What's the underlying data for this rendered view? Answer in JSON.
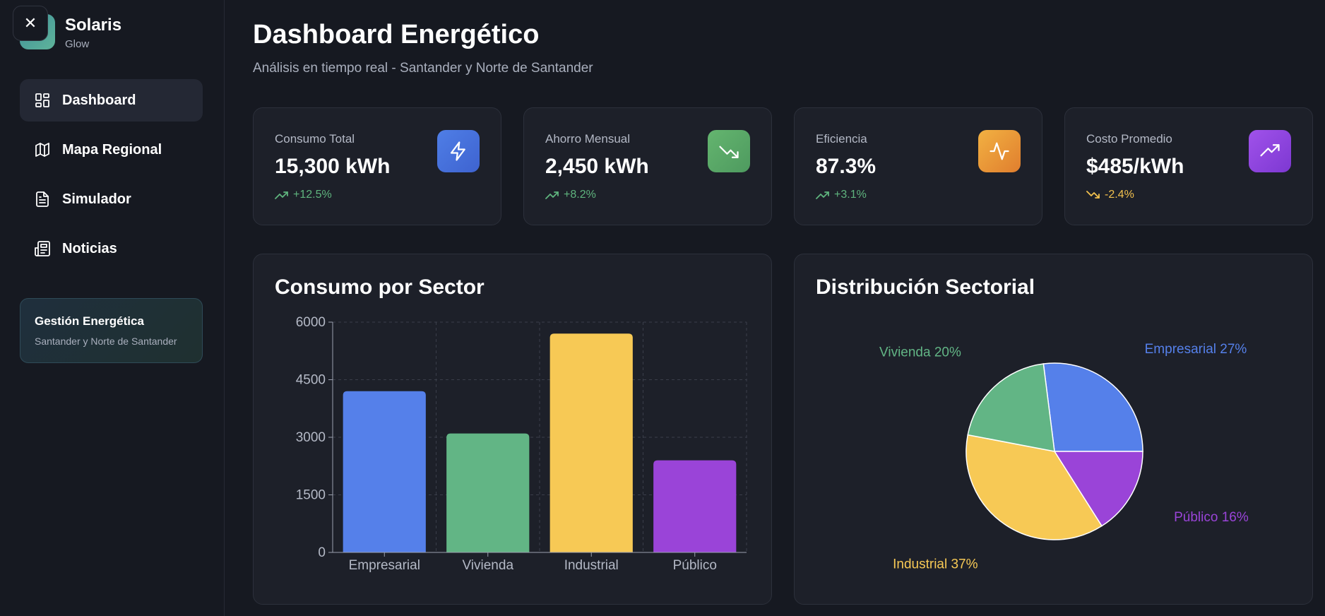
{
  "sidebar": {
    "brand_name": "Solaris",
    "brand_sub": "Glow",
    "close_symbol": "✕",
    "items": [
      {
        "label": "Dashboard",
        "icon": "dashboard-icon",
        "active": true
      },
      {
        "label": "Mapa Regional",
        "icon": "map-icon",
        "active": false
      },
      {
        "label": "Simulador",
        "icon": "document-icon",
        "active": false
      },
      {
        "label": "Noticias",
        "icon": "newspaper-icon",
        "active": false
      }
    ],
    "info_card": {
      "title": "Gestión Energética",
      "subtitle": "Santander y Norte de Santander"
    }
  },
  "header": {
    "title": "Dashboard Energético",
    "subtitle": "Análisis en tiempo real - Santander y Norte de Santander"
  },
  "kpis": [
    {
      "label": "Consumo Total",
      "value": "15,300 kWh",
      "change": "+12.5%",
      "trend": "up",
      "change_color": "#5fb47e",
      "icon": "lightning-icon",
      "icon_color": "#4f7ee6"
    },
    {
      "label": "Ahorro Mensual",
      "value": "2,450 kWh",
      "change": "+8.2%",
      "trend": "up",
      "change_color": "#5fb47e",
      "icon": "trending-down-icon",
      "icon_color": "#5aa86a"
    },
    {
      "label": "Eficiencia",
      "value": "87.3%",
      "change": "+3.1%",
      "trend": "up",
      "change_color": "#5fb47e",
      "icon": "activity-icon",
      "icon_color": "#e99a3a"
    },
    {
      "label": "Costo Promedio",
      "value": "$485/kWh",
      "change": "-2.4%",
      "trend": "down",
      "change_color": "#f2c14e",
      "icon": "trending-up-icon",
      "icon_color": "#9146e0"
    }
  ],
  "panels": {
    "bar_title": "Consumo por Sector",
    "pie_title": "Distribución Sectorial"
  },
  "chart_data": [
    {
      "type": "bar",
      "title": "Consumo por Sector",
      "categories": [
        "Empresarial",
        "Vivienda",
        "Industrial",
        "Público"
      ],
      "values": [
        4200,
        3100,
        5700,
        2400
      ],
      "colors": [
        "#5580ea",
        "#62b585",
        "#f7c955",
        "#9a44d8"
      ],
      "yticks": [
        "0",
        "1500",
        "3000",
        "4500",
        "6000"
      ],
      "ylim": [
        0,
        6000
      ],
      "grid": true
    },
    {
      "type": "pie",
      "title": "Distribución Sectorial",
      "slices": [
        {
          "label": "Empresarial 27%",
          "value": 27,
          "color": "#5580ea"
        },
        {
          "label": "Público 16%",
          "value": 16,
          "color": "#9a44d8"
        },
        {
          "label": "Industrial 37%",
          "value": 37,
          "color": "#f7c955"
        },
        {
          "label": "Vivienda 20%",
          "value": 20,
          "color": "#62b585"
        }
      ]
    }
  ]
}
